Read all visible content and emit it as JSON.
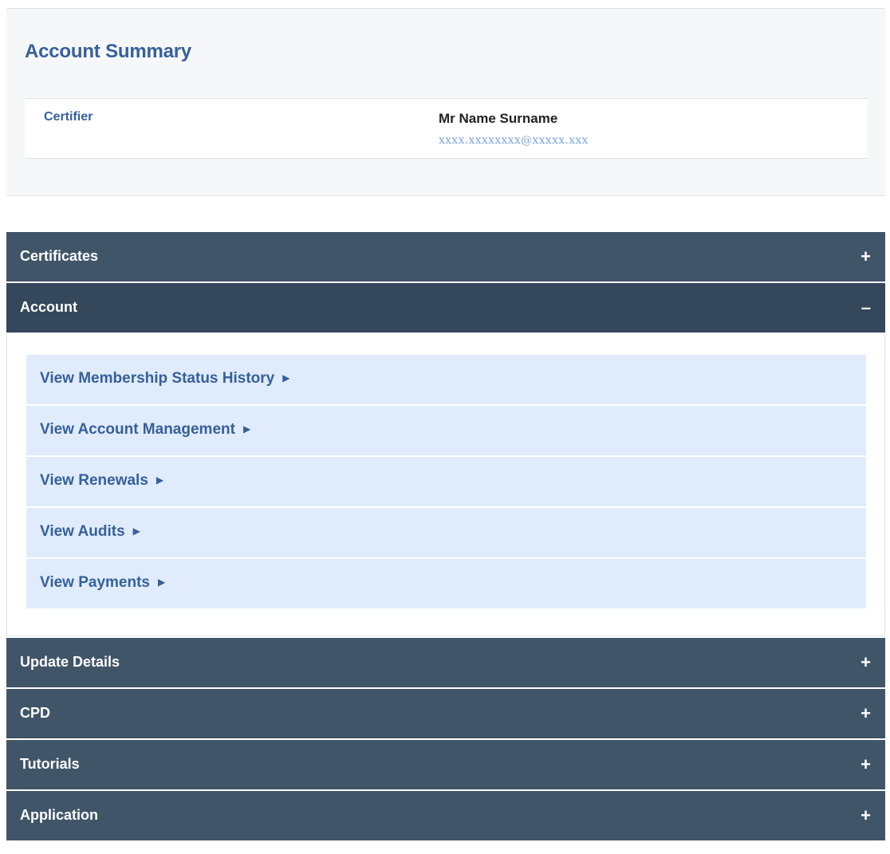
{
  "summary": {
    "title": "Account Summary",
    "certifier_label": "Certifier",
    "certifier_name": "Mr Name Surname",
    "certifier_email": "xxxx.xxxxxxxx@xxxxx.xxx"
  },
  "accordion": {
    "certificates": {
      "label": "Certificates",
      "toggle": "+"
    },
    "account": {
      "label": "Account",
      "toggle": "–",
      "links": [
        {
          "label": "View Membership Status History",
          "arrow": "▶"
        },
        {
          "label": "View Account Management",
          "arrow": "▶"
        },
        {
          "label": "View Renewals",
          "arrow": "▶"
        },
        {
          "label": "View Audits",
          "arrow": "▶"
        },
        {
          "label": "View Payments",
          "arrow": "▶"
        }
      ]
    },
    "update_details": {
      "label": "Update Details",
      "toggle": "+"
    },
    "cpd": {
      "label": "CPD",
      "toggle": "+"
    },
    "tutorials": {
      "label": "Tutorials",
      "toggle": "+"
    },
    "application": {
      "label": "Application",
      "toggle": "+"
    }
  },
  "colors": {
    "header_bg": "#415569",
    "header_open_bg": "#34475b",
    "link_bg": "#e0ecfb",
    "accent_text": "#36609a",
    "email_text": "#7fa7d6"
  }
}
